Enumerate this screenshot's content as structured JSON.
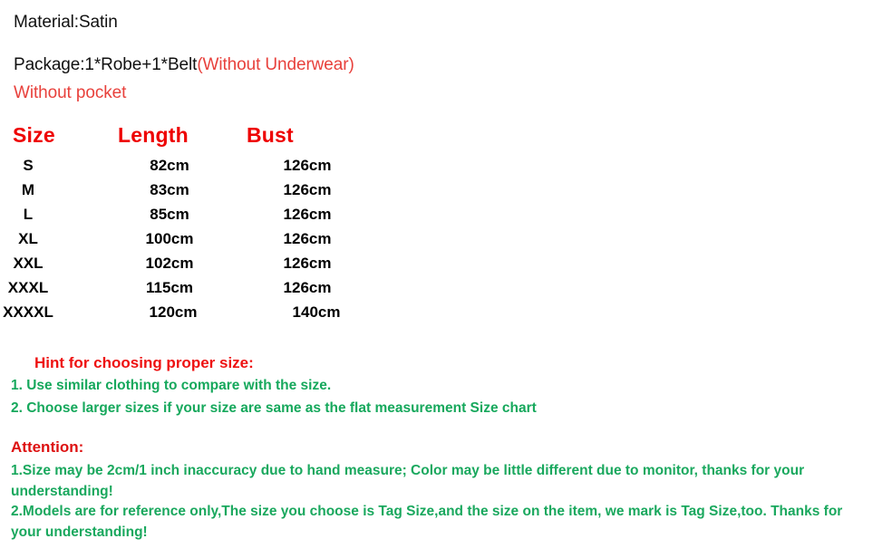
{
  "product_info": {
    "material_line": "Material:Satin",
    "package_label": "Package:1*Robe+1*Belt",
    "package_note": "(Without Underwear)",
    "pocket_note": "Without pocket"
  },
  "size_chart": {
    "headers": [
      "Size",
      "Length",
      "Bust"
    ],
    "rows": [
      {
        "size": "S",
        "length": "82cm",
        "bust": "126cm"
      },
      {
        "size": "M",
        "length": "83cm",
        "bust": "126cm"
      },
      {
        "size": "L",
        "length": "85cm",
        "bust": "126cm"
      },
      {
        "size": "XL",
        "length": "100cm",
        "bust": "126cm"
      },
      {
        "size": "XXL",
        "length": "102cm",
        "bust": "126cm"
      },
      {
        "size": "XXXL",
        "length": "115cm",
        "bust": "126cm"
      },
      {
        "size": "XXXXL",
        "length": "120cm",
        "bust": "140cm"
      }
    ]
  },
  "hint": {
    "title": "Hint for choosing proper size:",
    "items": [
      "1. Use similar clothing to compare with the size.",
      "2. Choose larger sizes if your size are same as the flat measurement Size chart"
    ]
  },
  "attention": {
    "title": "Attention:",
    "items": [
      "1.Size may be 2cm/1 inch inaccuracy due to hand measure; Color may be little different   due to monitor, thanks for your understanding!",
      "2.Models are for reference only,The size you choose is Tag Size,and the size on the item,  we mark is Tag Size,too. Thanks for your understanding!"
    ]
  },
  "colors": {
    "heading_red": "#ee0000",
    "note_red": "#e8413c",
    "attention_red": "#dd1111",
    "green": "#1aa85e",
    "text_black": "#111111",
    "background": "#ffffff"
  }
}
